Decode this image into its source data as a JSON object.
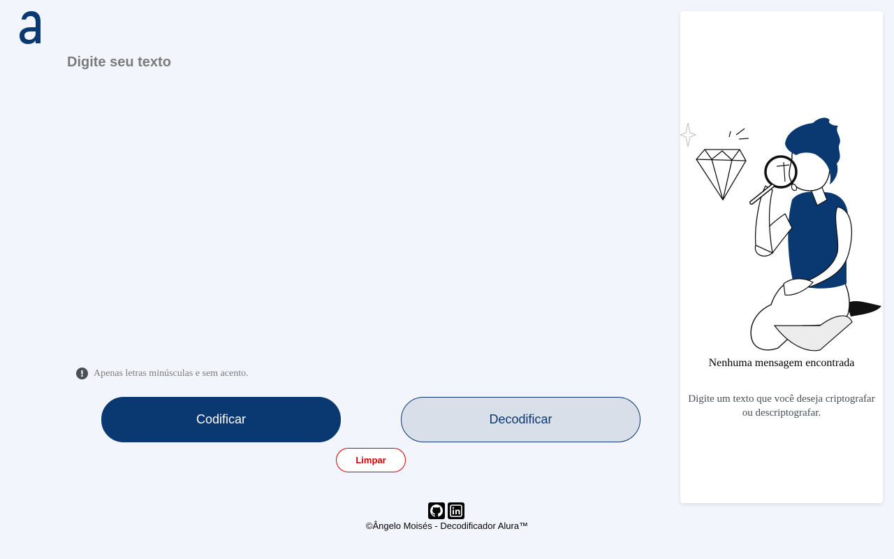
{
  "app": {
    "logo_icon": "alura-logo-icon",
    "brand_color": "#0a3871"
  },
  "input": {
    "placeholder": "Digite seu texto",
    "value": ""
  },
  "hint": {
    "icon": "exclamation-circle-icon",
    "text": "Apenas letras minúsculas e sem acento."
  },
  "buttons": {
    "encode_label": "Codificar",
    "decode_label": "Decodificar",
    "clear_label": "Limpar"
  },
  "footer": {
    "icons": [
      "github-icon",
      "linkedin-icon"
    ],
    "copyright": "©Ângelo Moisés - Decodificador Alura™"
  },
  "output_panel": {
    "illustration": "person-with-magnifying-glass-and-diamond",
    "title": "Nenhuma mensagem encontrada",
    "description": "Digite um texto que você deseja criptografar ou descriptografar."
  },
  "colors": {
    "background": "#f3f5fc",
    "primary": "#0a3871",
    "secondary_bg": "#d8dfe8",
    "danger": "#d00000"
  }
}
